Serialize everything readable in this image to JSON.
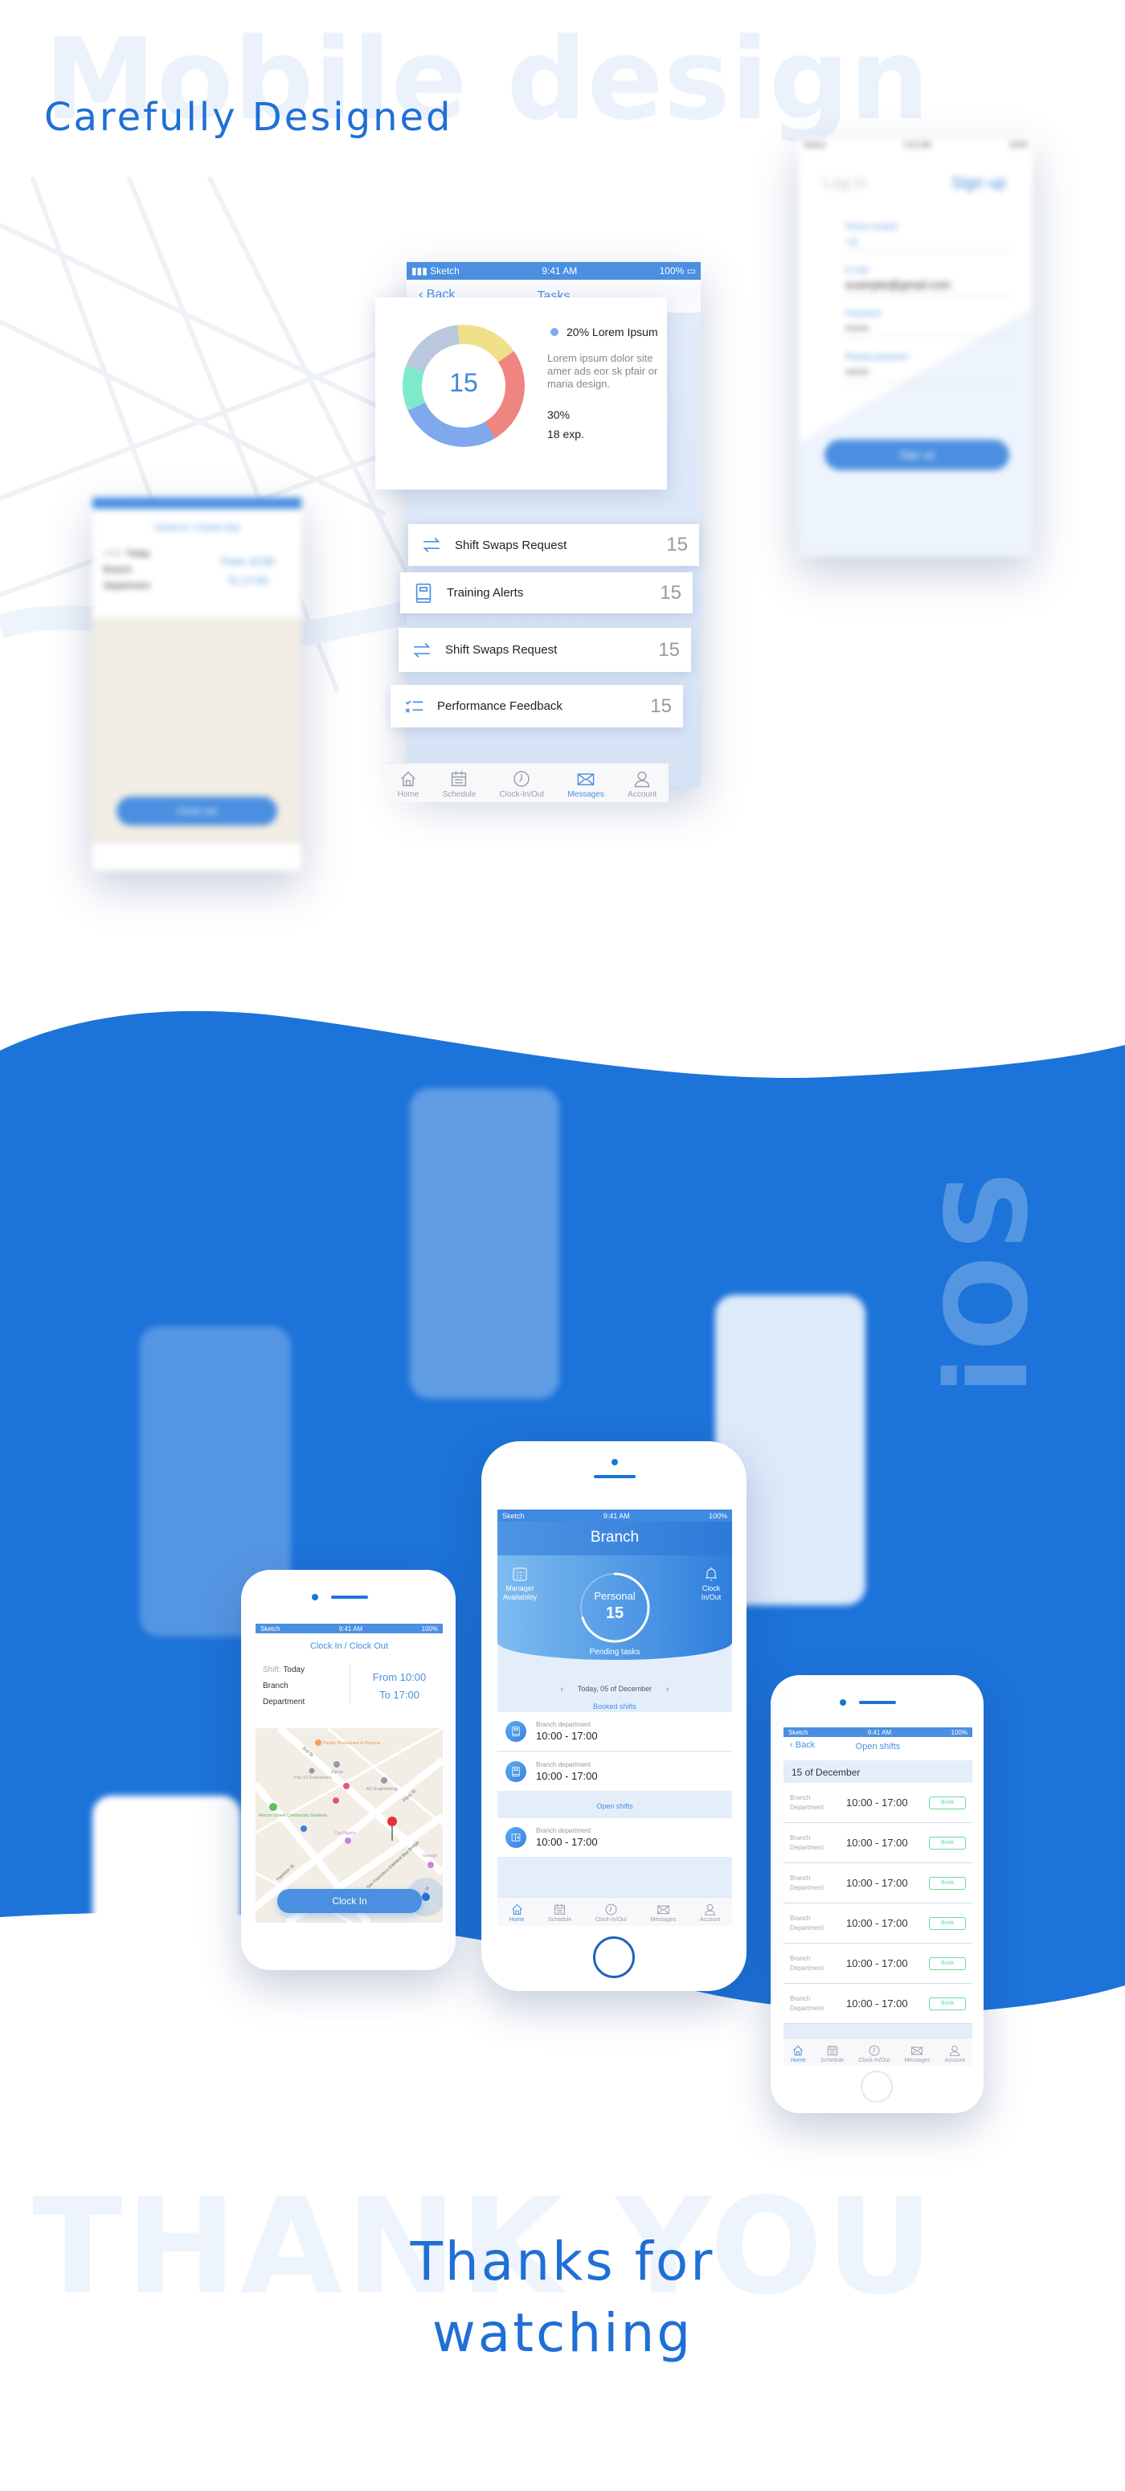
{
  "hero": {
    "watermark": "Mobile design",
    "heading": "Carefully Designed"
  },
  "status_bar": {
    "carrier": "Sketch",
    "time": "9:41 AM",
    "battery": "100%"
  },
  "tasks_screen": {
    "back": "Back",
    "title": "Tasks",
    "donut": {
      "center_value": "15",
      "legend": "20% Lorem Ipsum",
      "description": "Lorem ipsum dolor site amer ads eor sk pfair or maria design.",
      "stat1": "30%",
      "stat2": "18 exp.",
      "segments": [
        {
          "color": "#f0e08a",
          "value": 17
        },
        {
          "color": "#ee8580",
          "value": 26
        },
        {
          "color": "#7fa9ec",
          "value": 27
        },
        {
          "color": "#7feacb",
          "value": 12
        },
        {
          "color": "#b9c8dd",
          "value": 18
        }
      ],
      "legend_color": "#7fa9ec"
    },
    "items": [
      {
        "icon": "swap-arrows-icon",
        "label": "Shift Swaps Request",
        "count": "15"
      },
      {
        "icon": "book-icon",
        "label": "Training Alerts",
        "count": "15"
      },
      {
        "icon": "swap-arrows-icon",
        "label": "Shift Swaps Request",
        "count": "15"
      },
      {
        "icon": "checklist-icon",
        "label": "Performance Feedback",
        "count": "15"
      }
    ]
  },
  "tabs": [
    {
      "icon": "home-icon",
      "label": "Home"
    },
    {
      "icon": "calendar-icon",
      "label": "Schedule"
    },
    {
      "icon": "clock-icon",
      "label": "Clock-In/Out"
    },
    {
      "icon": "envelope-icon",
      "label": "Messages"
    },
    {
      "icon": "user-icon",
      "label": "Account"
    }
  ],
  "signup_screen": {
    "tab_login": "Log in",
    "tab_signup": "Sign up",
    "phone_label": "Phone number",
    "phone_value": "+1",
    "email_label": "E-mail",
    "email_value": "example@gmail.com",
    "password_label": "Password",
    "password_value": "••••••",
    "repeat_label": "Repeat password",
    "repeat_value": "••••••",
    "button": "Sign up"
  },
  "clock_screen_blurred": {
    "title": "Clock In / Clock Out",
    "shift_label": "Shift:",
    "shift_value": "Today",
    "branch": "Branch",
    "department": "Department",
    "from": "From 10:00",
    "to": "To 17:00",
    "button": "Clock out"
  },
  "ios_label": "iOS",
  "branch_screen": {
    "title": "Branch",
    "left_action": "Manager Availability",
    "right_action": "Clock In/Out",
    "ring_label": "Personal",
    "ring_value": "15",
    "ring_progress": 0.7,
    "ring_caption": "Pending tasks",
    "date": "Today, 05 of December",
    "booked_header": "Booked shifts",
    "open_header": "Open shifts",
    "booked": [
      {
        "dept": "Branch department",
        "time": "10:00 - 17:00"
      },
      {
        "dept": "Branch department",
        "time": "10:00 - 17:00"
      }
    ],
    "open": [
      {
        "dept": "Branch department",
        "time": "10:00 - 17:00"
      }
    ]
  },
  "clock_screen": {
    "title": "Clock In / Clock Out",
    "shift_label": "Shift:",
    "shift_value": "Today",
    "branch": "Branch",
    "department": "Department",
    "from": "From 10:00",
    "to": "To 17:00",
    "button": "Clock In",
    "map_labels": [
      "Pacific Restaurant & Pizzeria",
      "Zipcar",
      "Pac 12 Enterprises",
      "KC Engineering",
      "Rincon Street Community Gardens",
      "City Nights",
      "San Francisco-Oakland Bay Bridge",
      "Harrison St",
      "Perry St",
      "2nd St",
      "Bryant St",
      "Garage"
    ]
  },
  "open_shifts_screen": {
    "back": "Back",
    "title": "Open shifts",
    "date": "15 of December",
    "rows": [
      {
        "dept": "Branch Department",
        "time": "10:00 - 17:00",
        "action": "Book"
      },
      {
        "dept": "Branch Department",
        "time": "10:00 - 17:00",
        "action": "Book"
      },
      {
        "dept": "Branch Department",
        "time": "10:00 - 17:00",
        "action": "Book"
      },
      {
        "dept": "Branch Department",
        "time": "10:00 - 17:00",
        "action": "Book"
      },
      {
        "dept": "Branch Department",
        "time": "10:00 - 17:00",
        "action": "Book"
      },
      {
        "dept": "Branch Department",
        "time": "10:00 - 17:00",
        "action": "Book"
      }
    ]
  },
  "footer": {
    "watermark": "THANK YOU",
    "line1": "Thanks for",
    "line2": "watching"
  },
  "colors": {
    "brand_blue": "#1c73d9",
    "accent": "#4a8fe0",
    "book_green": "#5fdca0"
  }
}
